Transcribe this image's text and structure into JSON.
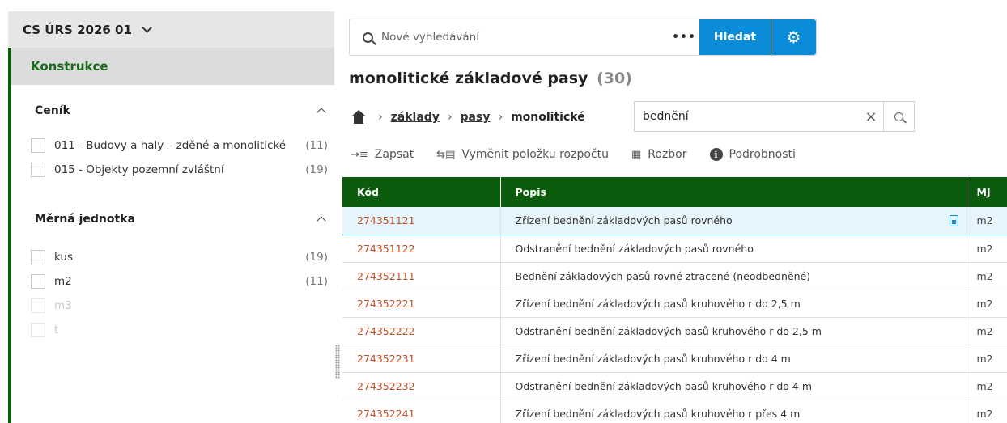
{
  "sidebar": {
    "version": "CS ÚRS 2026 01",
    "section": "Konstrukce",
    "groups": [
      {
        "title": "Ceník",
        "items": [
          {
            "label": "011 - Budovy a haly – zděné a monolitické",
            "count": "(11)"
          },
          {
            "label": "015 - Objekty pozemní zvláštní",
            "count": "(19)"
          }
        ]
      },
      {
        "title": "Měrná jednotka",
        "items": [
          {
            "label": "kus",
            "count": "(19)"
          },
          {
            "label": "m2",
            "count": "(11)"
          },
          {
            "label": "m3",
            "count": ""
          },
          {
            "label": "t",
            "count": ""
          }
        ]
      }
    ]
  },
  "search": {
    "placeholder": "Nové vyhledávání",
    "more": "•••",
    "button": "Hledat",
    "settings_icon": "gear-icon"
  },
  "title": {
    "text": "monolitické základové pasy",
    "count": "(30)"
  },
  "breadcrumb": {
    "home_icon": "home-icon",
    "items": [
      "základy",
      "pasy"
    ],
    "current": "monolitické"
  },
  "filter": {
    "value": "bednění",
    "clear": "×"
  },
  "toolbar": {
    "write": "Zapsat",
    "replace": "Vyměnit položku rozpočtu",
    "analysis": "Rozbor",
    "details": "Podrobnosti"
  },
  "table": {
    "headers": [
      "Kód",
      "Popis",
      "MJ"
    ],
    "rows": [
      {
        "code": "274351121",
        "desc": "Zřízení bednění základových pasů rovného",
        "unit": "m2"
      },
      {
        "code": "274351122",
        "desc": "Odstranění bednění základových pasů rovného",
        "unit": "m2"
      },
      {
        "code": "274352111",
        "desc": "Bednění základových pasů rovné ztracené (neodbedněné)",
        "unit": "m2"
      },
      {
        "code": "274352221",
        "desc": "Zřízení bednění základových pasů kruhového r do 2,5 m",
        "unit": "m2"
      },
      {
        "code": "274352222",
        "desc": "Odstranění bednění základových pasů kruhového r do 2,5 m",
        "unit": "m2"
      },
      {
        "code": "274352231",
        "desc": "Zřízení bednění základových pasů kruhového r do 4 m",
        "unit": "m2"
      },
      {
        "code": "274352232",
        "desc": "Odstranění bednění základových pasů kruhového r do 4 m",
        "unit": "m2"
      },
      {
        "code": "274352241",
        "desc": "Zřízení bednění základových pasů kruhového r přes 4 m",
        "unit": "m2"
      }
    ]
  },
  "colors": {
    "accent": "#0a8cd8",
    "header_green": "#0d5c0d",
    "code_orange": "#c0502a"
  }
}
